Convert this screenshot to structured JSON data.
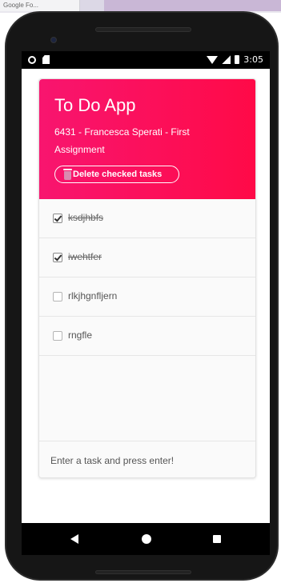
{
  "desktop": {
    "tab_label": "Google Fo..."
  },
  "statusbar": {
    "time": "3:05"
  },
  "app": {
    "title": "To Do App",
    "subtitle": "6431 - Francesca Sperati - First Assignment",
    "delete_button_label": "Delete checked tasks"
  },
  "tasks": [
    {
      "label": "ksdjhbfs",
      "checked": true
    },
    {
      "label": "iwehtfer",
      "checked": true
    },
    {
      "label": "rlkjhgnfljern",
      "checked": false
    },
    {
      "label": "rngfle",
      "checked": false
    }
  ],
  "input": {
    "placeholder": "Enter a task and press enter!"
  },
  "colors": {
    "header_start": "#f8156f",
    "header_end": "#ff0a47"
  },
  "icons": {
    "delete_button": "trash-icon",
    "nav": [
      "back-icon",
      "home-icon",
      "recents-icon"
    ]
  }
}
